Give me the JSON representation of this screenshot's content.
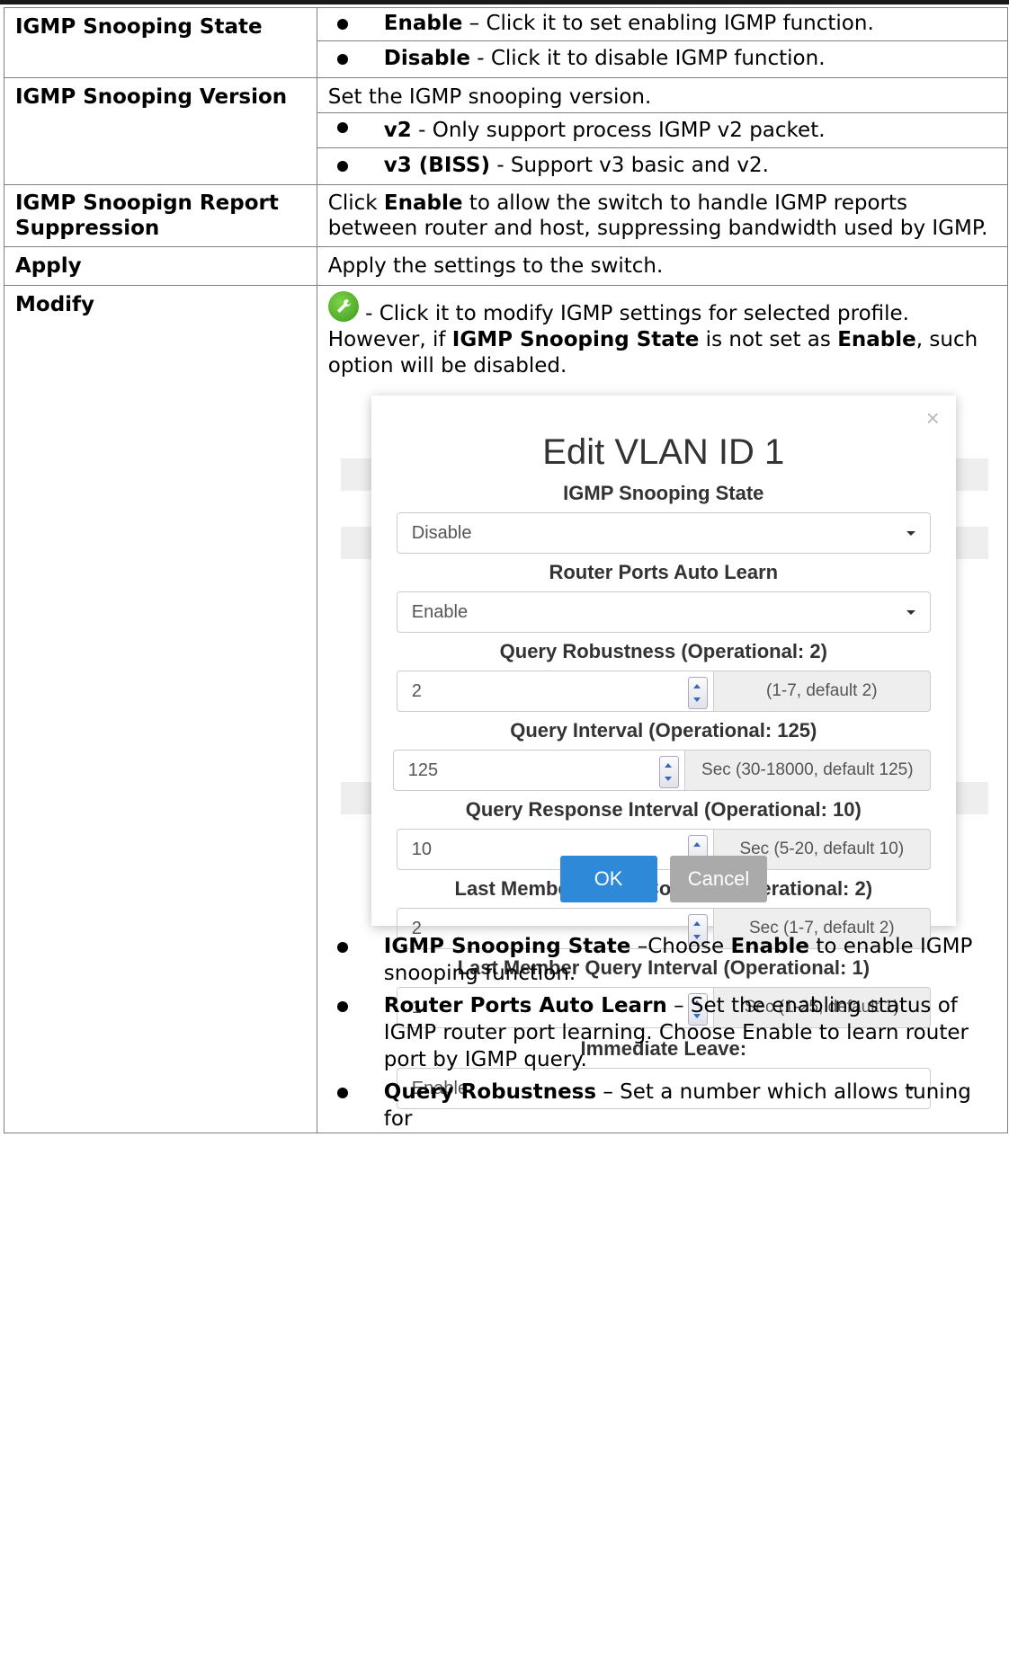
{
  "rows": {
    "state": {
      "name": "IGMP Snooping State",
      "items": [
        {
          "term": "Enable",
          "text": " – Click it to set enabling IGMP function."
        },
        {
          "term": "Disable",
          "text": " - Click it to disable IGMP function."
        }
      ]
    },
    "version": {
      "name": "IGMP Snooping Version",
      "intro": "Set the IGMP snooping version.",
      "items": [
        {
          "term": "v2",
          "text": " - Only support process IGMP v2 packet."
        },
        {
          "term": "v3 (BISS)",
          "text": " - Support v3 basic and v2."
        }
      ]
    },
    "suppression": {
      "name": "IGMP Snoopign Report Suppression",
      "pre": "Click ",
      "term": "Enable",
      "post": " to allow the switch to handle IGMP reports between router and host, suppressing bandwidth used by IGMP."
    },
    "apply": {
      "name": "Apply",
      "text": "Apply the settings to the switch."
    },
    "modify": {
      "name": "Modify",
      "icon": "wrench-icon",
      "text1": " - Click it to modify IGMP settings for selected profile. However, if ",
      "term1": "IGMP Snooping State",
      "text2": " is not set as ",
      "term2": "Enable",
      "text3": ", such option will be disabled.",
      "bullets": [
        {
          "term": "IGMP Snooping State",
          "text": " –Choose ",
          "term2": "Enable",
          "text2": " to enable IGMP snooping function."
        },
        {
          "term": "Router Ports Auto Learn",
          "text": " – Set the enabling status of IGMP router port learning. Choose Enable to learn router port by IGMP query.",
          "term2": "",
          "text2": ""
        },
        {
          "term": "Query Robustness",
          "text": " – Set a number which allows tuning for",
          "term2": "",
          "text2": ""
        }
      ]
    }
  },
  "dialog": {
    "title": "Edit VLAN ID 1",
    "close": "×",
    "state_label": "IGMP Snooping State",
    "state_value": "Disable",
    "autolearn_label": "Router Ports Auto Learn",
    "autolearn_value": "Enable",
    "robust_label": "Query Robustness (Operational: 2)",
    "robust_value": "2",
    "robust_hint": "(1-7, default 2)",
    "qint_label": "Query Interval (Operational: 125)",
    "qint_value": "125",
    "qint_hint": "Sec (30-18000, default 125)",
    "qresp_label": "Query Response Interval (Operational: 10)",
    "qresp_value": "10",
    "qresp_hint": "Sec (5-20, default 10)",
    "lmqc_label": "Last Member Query Counter (Operational: 2)",
    "lmqc_value": "2",
    "lmqc_hint": "Sec (1-7, default 2)",
    "lmqi_label": "Last Member Query Interval (Operational: 1)",
    "lmqi_value": "1",
    "lmqi_hint": "Sec (1-25, default 1)",
    "leave_label": "Immediate Leave:",
    "leave_value": "Enable",
    "ok": "OK",
    "cancel": "Cancel",
    "colors": {
      "ok": "#2e8ad8",
      "cancel": "#aaaaaa",
      "icon": "#4caf28"
    }
  }
}
